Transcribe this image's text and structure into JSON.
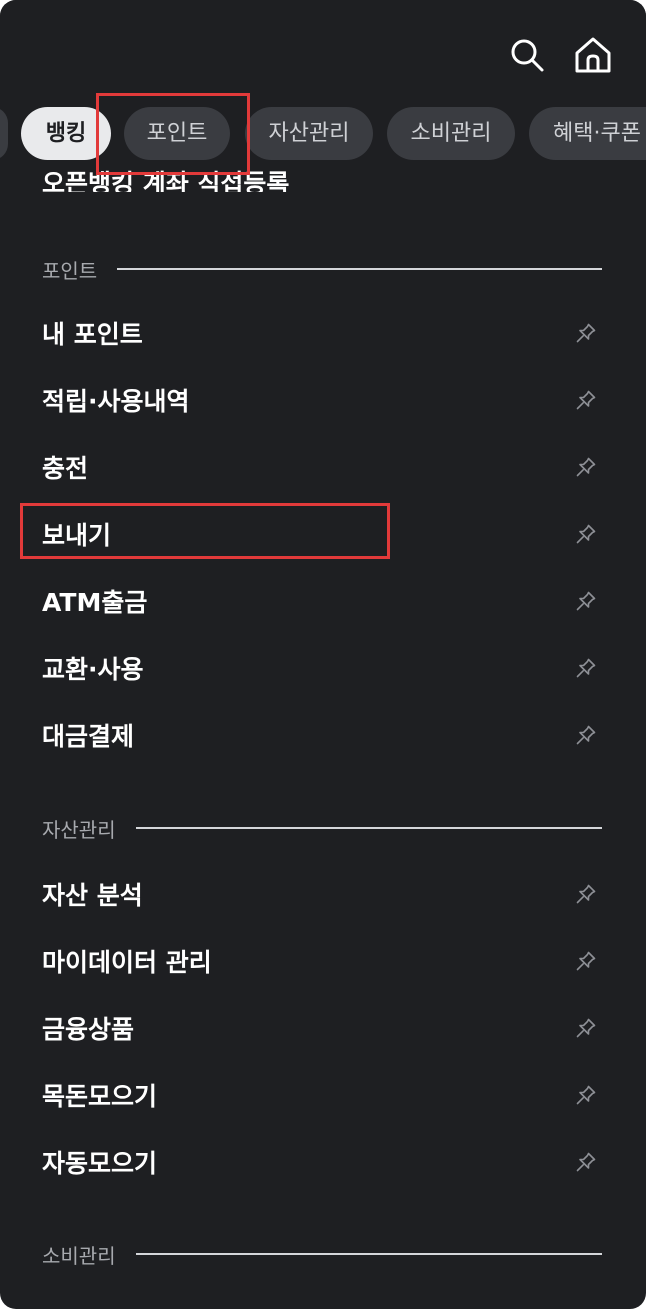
{
  "header": {
    "search_icon": "search-icon",
    "home_icon": "home-icon"
  },
  "tabs": [
    {
      "label": "",
      "active": false
    },
    {
      "label": "뱅킹",
      "active": true
    },
    {
      "label": "포인트",
      "active": false
    },
    {
      "label": "자산관리",
      "active": false
    },
    {
      "label": "소비관리",
      "active": false
    },
    {
      "label": "혜택·쿠폰",
      "active": false
    }
  ],
  "cut_off_item": {
    "label": "오픈뱅킹 계좌 직접등록"
  },
  "sections": {
    "point": {
      "title": "포인트",
      "items": [
        {
          "label": "내 포인트"
        },
        {
          "label": "적립·사용내역"
        },
        {
          "label": "충전"
        },
        {
          "label": "보내기"
        },
        {
          "label": "ATM출금"
        },
        {
          "label": "교환·사용"
        },
        {
          "label": "대금결제"
        }
      ]
    },
    "asset": {
      "title": "자산관리",
      "items": [
        {
          "label": "자산 분석"
        },
        {
          "label": "마이데이터 관리"
        },
        {
          "label": "금융상품"
        },
        {
          "label": "목돈모으기"
        },
        {
          "label": "자동모으기"
        }
      ]
    },
    "spend": {
      "title": "소비관리"
    }
  },
  "colors": {
    "background": "#1e1f22",
    "tab_bg": "#3a3c41",
    "tab_active_bg": "#e9eaec",
    "section_text": "#a7a9ae",
    "highlight": "#e23a3a"
  }
}
